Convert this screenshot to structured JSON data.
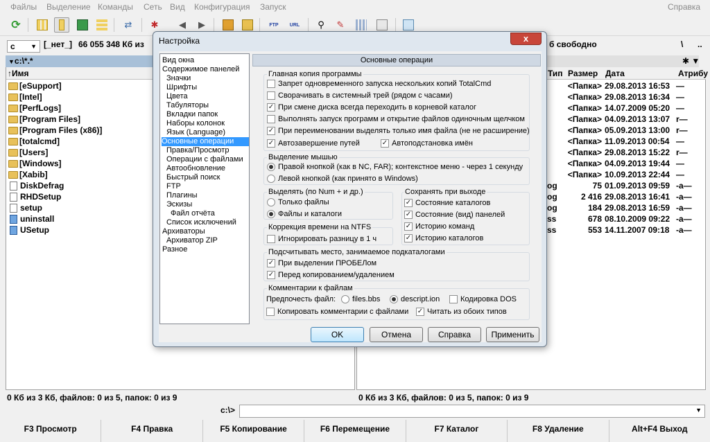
{
  "menu": {
    "items": [
      "Файлы",
      "Выделение",
      "Команды",
      "Сеть",
      "Вид",
      "Конфигурация",
      "Запуск"
    ],
    "help": "Справка"
  },
  "left_panel": {
    "drive": "c",
    "volume_label": "[_нет_]",
    "free_space": "66 055 348 Кб из",
    "path": "c:\\*.*",
    "col_name": "↑Имя",
    "items": [
      {
        "name": "[eSupport]",
        "type": "folder"
      },
      {
        "name": "[Intel]",
        "type": "folder"
      },
      {
        "name": "[PerfLogs]",
        "type": "folder"
      },
      {
        "name": "[Program Files]",
        "type": "folder"
      },
      {
        "name": "[Program Files (x86)]",
        "type": "folder"
      },
      {
        "name": "[totalcmd]",
        "type": "folder"
      },
      {
        "name": "[Users]",
        "type": "folder"
      },
      {
        "name": "[Windows]",
        "type": "folder"
      },
      {
        "name": "[Xabib]",
        "type": "folder"
      },
      {
        "name": "DiskDefrag",
        "type": "file"
      },
      {
        "name": "RHDSetup",
        "type": "file"
      },
      {
        "name": "setup",
        "type": "file"
      },
      {
        "name": "uninstall",
        "type": "exe"
      },
      {
        "name": "USetup",
        "type": "exe"
      }
    ],
    "status": "0 Кб из 3 Кб, файлов: 0 из 5, папок: 0 из 9"
  },
  "right_panel": {
    "free_space": "б свободно",
    "col_type": "Тип",
    "col_size": "Размер",
    "col_date": "Дата",
    "col_attr": "Атрибу",
    "rows": [
      {
        "ext": "",
        "size": "<Папка>",
        "date": "29.08.2013 16:53",
        "attr": "—"
      },
      {
        "ext": "",
        "size": "<Папка>",
        "date": "29.08.2013 16:34",
        "attr": "—"
      },
      {
        "ext": "",
        "size": "<Папка>",
        "date": "14.07.2009 05:20",
        "attr": "—"
      },
      {
        "ext": "",
        "size": "<Папка>",
        "date": "04.09.2013 13:07",
        "attr": "r—"
      },
      {
        "ext": "",
        "size": "<Папка>",
        "date": "05.09.2013 13:00",
        "attr": "r—"
      },
      {
        "ext": "",
        "size": "<Папка>",
        "date": "11.09.2013 00:54",
        "attr": "—"
      },
      {
        "ext": "",
        "size": "<Папка>",
        "date": "29.08.2013 15:22",
        "attr": "r—"
      },
      {
        "ext": "",
        "size": "<Папка>",
        "date": "04.09.2013 19:44",
        "attr": "—"
      },
      {
        "ext": "",
        "size": "<Папка>",
        "date": "10.09.2013 22:44",
        "attr": "—"
      },
      {
        "ext": "og",
        "size": "75",
        "date": "01.09.2013 09:59",
        "attr": "-a—"
      },
      {
        "ext": "og",
        "size": "2 416",
        "date": "29.08.2013 16:41",
        "attr": "-a—"
      },
      {
        "ext": "og",
        "size": "184",
        "date": "29.08.2013 16:59",
        "attr": "-a—"
      },
      {
        "ext": "ss",
        "size": "678",
        "date": "08.10.2009 09:22",
        "attr": "-a—"
      },
      {
        "ext": "ss",
        "size": "553",
        "date": "14.11.2007 09:18",
        "attr": "-a—"
      }
    ],
    "status": "0 Кб из 3 Кб, файлов: 0 из 5, папок: 0 из 9"
  },
  "command_line": {
    "prompt": "c:\\>",
    "value": ""
  },
  "fkeys": [
    "F3 Просмотр",
    "F4 Правка",
    "F5 Копирование",
    "F6 Перемещение",
    "F7 Каталог",
    "F8 Удаление",
    "Alt+F4 Выход"
  ],
  "dialog": {
    "title": "Настройка",
    "close_glyph": "x",
    "tree": [
      {
        "label": "Вид окна",
        "indent": 0
      },
      {
        "label": "Содержимое панелей",
        "indent": 0
      },
      {
        "label": "Значки",
        "indent": 1
      },
      {
        "label": "Шрифты",
        "indent": 1
      },
      {
        "label": "Цвета",
        "indent": 1
      },
      {
        "label": "Табуляторы",
        "indent": 1
      },
      {
        "label": "Вкладки папок",
        "indent": 1
      },
      {
        "label": "Наборы колонок",
        "indent": 1
      },
      {
        "label": "Язык (Language)",
        "indent": 1
      },
      {
        "label": "Основные операции",
        "indent": 0,
        "selected": true
      },
      {
        "label": "Правка/Просмотр",
        "indent": 1
      },
      {
        "label": "Операции с файлами",
        "indent": 1
      },
      {
        "label": "Автообновление",
        "indent": 1
      },
      {
        "label": "Быстрый поиск",
        "indent": 1
      },
      {
        "label": "FTP",
        "indent": 1
      },
      {
        "label": "Плагины",
        "indent": 1
      },
      {
        "label": "Эскизы",
        "indent": 1
      },
      {
        "label": "Файл отчёта",
        "indent": 2
      },
      {
        "label": "Список исключений",
        "indent": 1
      },
      {
        "label": "Архиваторы",
        "indent": 0
      },
      {
        "label": "Архиватор ZIP",
        "indent": 1
      },
      {
        "label": "Разное",
        "indent": 0
      }
    ],
    "section_title": "Основные операции",
    "main_copy": {
      "title": "Главная копия программы",
      "options": [
        {
          "label": "Запрет одновременного запуска нескольких копий TotalCmd",
          "checked": false
        },
        {
          "label": "Сворачивать в системный трей (рядом с часами)",
          "checked": false
        },
        {
          "label": "При смене диска всегда переходить в корневой каталог",
          "checked": true
        },
        {
          "label": "Выполнять запуск программ и открытие файлов одиночным щелчком",
          "checked": false
        },
        {
          "label": "При переименовании выделять только имя файла (не не расширение)",
          "checked": true
        },
        {
          "label": "Автозавершение путей",
          "checked": true
        },
        {
          "label": "Автоподстановка имён",
          "checked": true
        }
      ]
    },
    "mouse": {
      "title": "Выделение мышью",
      "options": [
        {
          "label": "Правой кнопкой (как в NC, FAR); контекстное меню - через 1 секунду",
          "selected": true
        },
        {
          "label": "Левой кнопкой (как принято в Windows)",
          "selected": false
        }
      ]
    },
    "num_select": {
      "title": "Выделять (по Num + и др.)",
      "options": [
        {
          "label": "Только файлы",
          "selected": false
        },
        {
          "label": "Файлы и каталоги",
          "selected": true
        }
      ]
    },
    "save_on_exit": {
      "title": "Сохранять при выходе",
      "options": [
        {
          "label": "Состояние каталогов",
          "checked": true
        },
        {
          "label": "Состояние (вид) панелей",
          "checked": true
        },
        {
          "label": "Историю команд",
          "checked": true
        },
        {
          "label": "Историю каталогов",
          "checked": true
        }
      ]
    },
    "ntfs": {
      "title": "Коррекция времени на NTFS",
      "option": {
        "label": "Игнорировать разницу в 1 ч",
        "checked": false
      }
    },
    "space": {
      "title": "Подсчитывать место, занимаемое подкаталогами",
      "options": [
        {
          "label": "При выделении ПРОБЕЛом",
          "checked": true
        },
        {
          "label": "Перед копированием/удалением",
          "checked": true
        }
      ]
    },
    "comments": {
      "title": "Комментарии к файлам",
      "prefer_label": "Предпочесть файл:",
      "radio1": {
        "label": "files.bbs",
        "selected": false
      },
      "radio2": {
        "label": "descript.ion",
        "selected": true
      },
      "dos": {
        "label": "Кодировка DOS",
        "checked": false
      },
      "copy": {
        "label": "Копировать комментарии с файлами",
        "checked": false
      },
      "read": {
        "label": "Читать из обоих типов",
        "checked": true
      }
    },
    "buttons": {
      "ok": "OK",
      "cancel": "Отмена",
      "help": "Справка",
      "apply": "Применить"
    }
  }
}
